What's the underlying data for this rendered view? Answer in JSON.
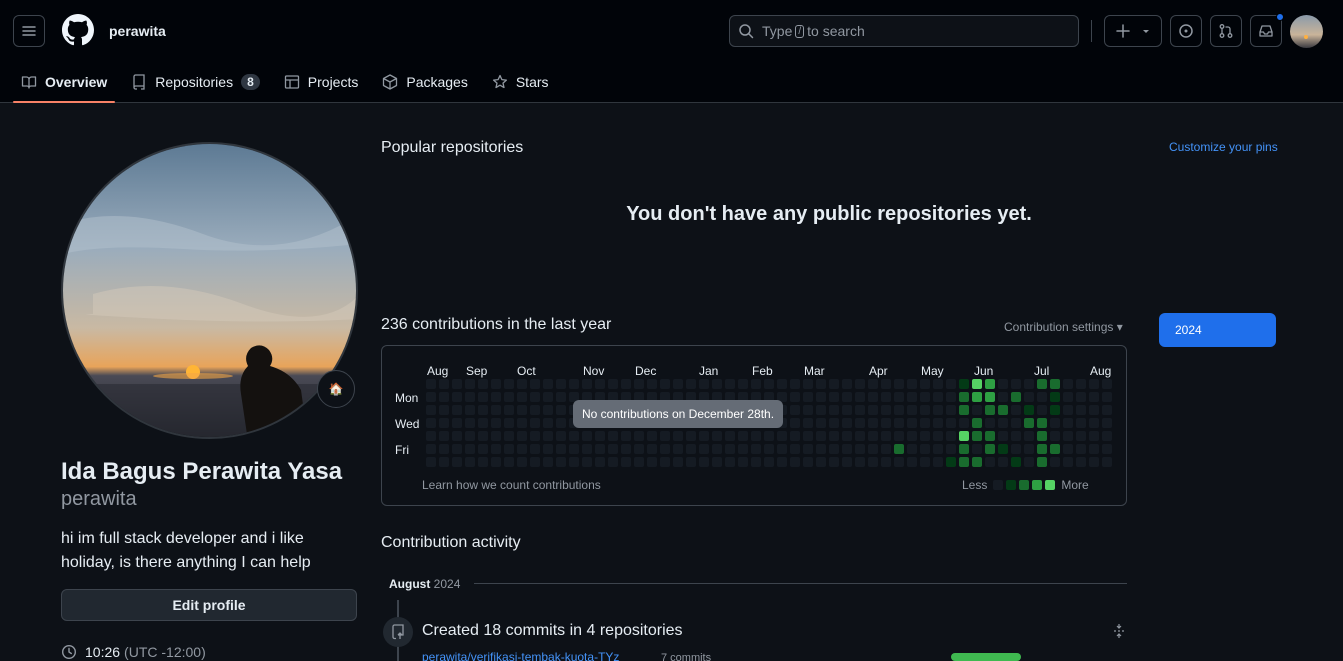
{
  "header": {
    "username": "perawita",
    "search_prefix": "Type",
    "search_key": "/",
    "search_suffix": "to search",
    "menu_icon": "hamburger-icon",
    "logo_icon": "github-logo-icon"
  },
  "tabs": [
    {
      "label": "Overview",
      "icon": "book-icon",
      "active": true
    },
    {
      "label": "Repositories",
      "icon": "repo-icon",
      "count": "8"
    },
    {
      "label": "Projects",
      "icon": "table-icon"
    },
    {
      "label": "Packages",
      "icon": "package-icon"
    },
    {
      "label": "Stars",
      "icon": "star-icon"
    }
  ],
  "profile": {
    "full_name": "Ida Bagus Perawita Yasa",
    "login": "perawita",
    "bio": "hi im full stack developer and i like holiday, is there anything I can help",
    "edit_label": "Edit profile",
    "time": "10:26",
    "timezone": "(UTC -12:00)",
    "status_emoji": "🏠"
  },
  "popular": {
    "title": "Popular repositories",
    "customize": "Customize your pins",
    "empty": "You don't have any public repositories yet."
  },
  "contributions": {
    "title": "236 contributions in the last year",
    "settings": "Contribution settings ▾",
    "year": "2024",
    "months": [
      "Aug",
      "Sep",
      "Oct",
      "Nov",
      "Dec",
      "Jan",
      "Feb",
      "Mar",
      "Apr",
      "May",
      "Jun",
      "Jul",
      "Aug"
    ],
    "days": [
      "Mon",
      "Wed",
      "Fri"
    ],
    "tooltip": "No contributions on December 28th.",
    "learn": "Learn how we count contributions",
    "less": "Less",
    "more": "More",
    "colors": [
      "#151b23",
      "#033a16",
      "#196c2e",
      "#2ea043",
      "#56d364"
    ]
  },
  "activity": {
    "title": "Contribution activity",
    "month": "August",
    "year": "2024",
    "summary": "Created 18 commits in 4 repositories",
    "repo": "perawita/verifikasi-tembak-kuota-TYz",
    "repo_commits": "7 commits"
  }
}
